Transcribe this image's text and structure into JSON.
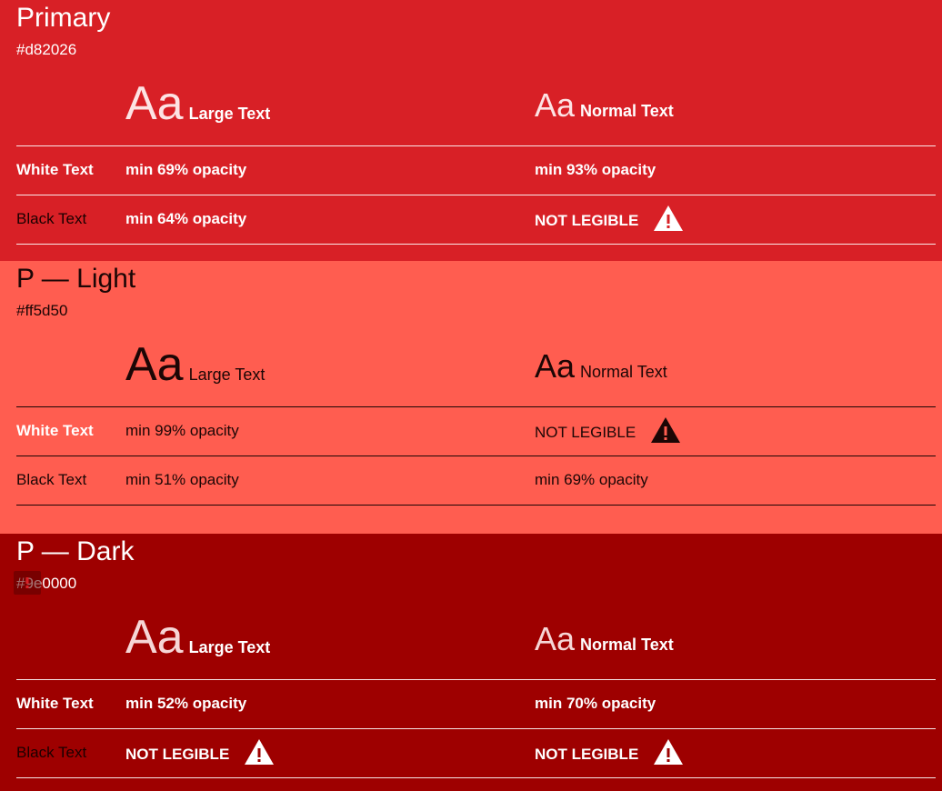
{
  "labels": {
    "large_sample": "Aa",
    "large_text": "Large Text",
    "normal_sample": "Aa",
    "normal_text": "Normal Text",
    "white_text": "White Text",
    "black_text": "Black Text"
  },
  "colors": {
    "primary": "#d82026",
    "light": "#ff5d50",
    "dark": "#9e0000"
  },
  "sections": [
    {
      "title": "Primary",
      "hex": "#d82026",
      "white_large": "min 69% opacity",
      "white_normal": "min 93% opacity",
      "black_large": "min 64% opacity",
      "black_normal": "NOT LEGIBLE"
    },
    {
      "title": "P — Light",
      "hex": "#ff5d50",
      "white_large": "min 99% opacity",
      "white_normal": "NOT LEGIBLE",
      "black_large": "min 51% opacity",
      "black_normal": "min 69% opacity"
    },
    {
      "title": "P — Dark",
      "hex": "#9e0000",
      "white_large": "min 52% opacity",
      "white_normal": "min 70% opacity",
      "black_large": "NOT LEGIBLE",
      "black_normal": "NOT LEGIBLE"
    }
  ],
  "icons": {
    "warning": "warning-triangle-icon"
  }
}
